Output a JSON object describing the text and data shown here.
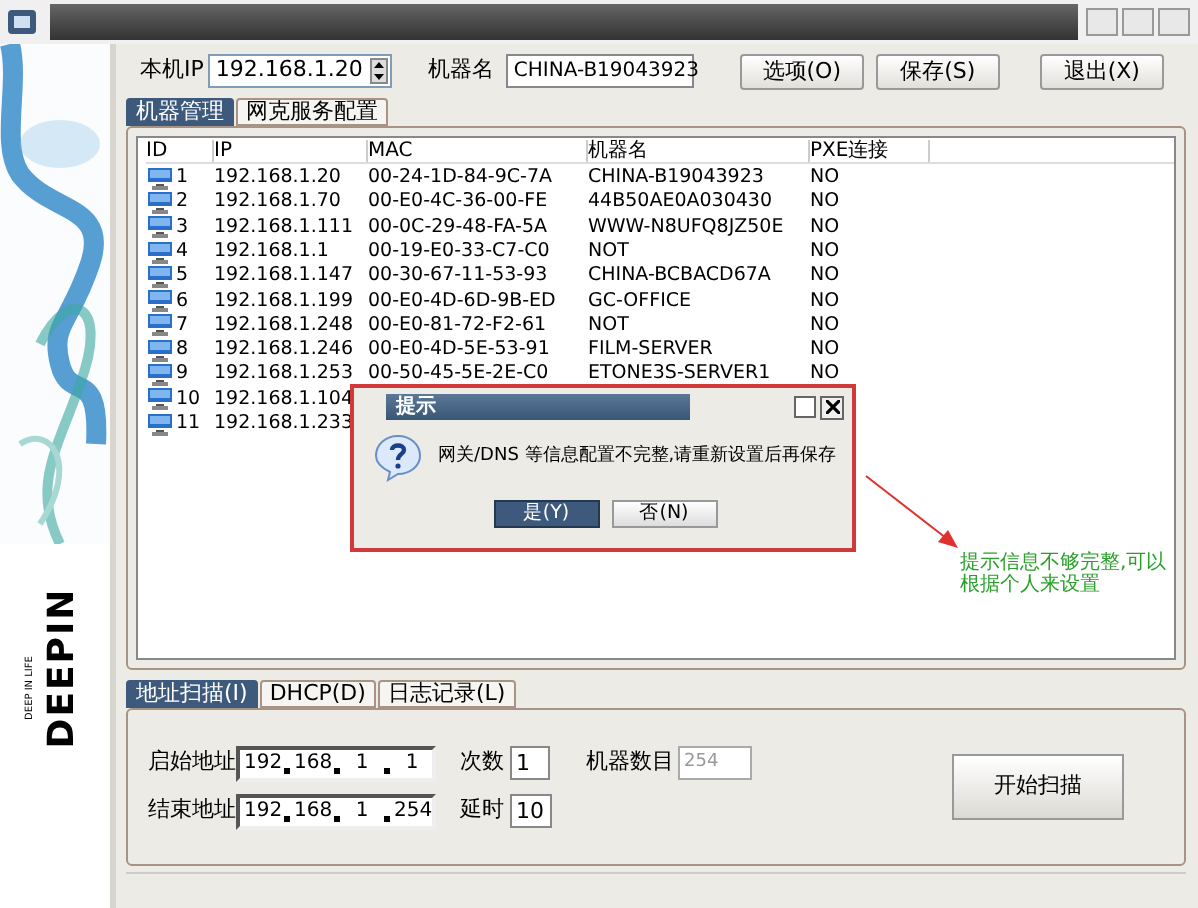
{
  "brand": {
    "wordmark": "DEEPIN",
    "tagline": "DEEP IN LIFE"
  },
  "top": {
    "ip_label": "本机IP",
    "ip_value": "192.168.1.20",
    "name_label": "机器名",
    "name_value": "CHINA-B19043923",
    "buttons": [
      "选项(O)",
      "保存(S)",
      "退出(X)"
    ]
  },
  "tabs": [
    {
      "label": "机器管理",
      "selected": true
    },
    {
      "label": "网克服务配置",
      "selected": false
    }
  ],
  "table": {
    "columns": [
      "ID",
      "IP",
      "MAC",
      "机器名",
      "PXE连接"
    ],
    "rows": [
      {
        "id": "1",
        "ip": "192.168.1.20",
        "mac": "00-24-1D-84-9C-7A",
        "name": "CHINA-B19043923",
        "pxe": "NO"
      },
      {
        "id": "2",
        "ip": "192.168.1.70",
        "mac": "00-E0-4C-36-00-FE",
        "name": "44B50AE0A030430",
        "pxe": "NO"
      },
      {
        "id": "3",
        "ip": "192.168.1.111",
        "mac": "00-0C-29-48-FA-5A",
        "name": "WWW-N8UFQ8JZ50E",
        "pxe": "NO"
      },
      {
        "id": "4",
        "ip": "192.168.1.1",
        "mac": "00-19-E0-33-C7-C0",
        "name": "NOT",
        "pxe": "NO"
      },
      {
        "id": "5",
        "ip": "192.168.1.147",
        "mac": "00-30-67-11-53-93",
        "name": "CHINA-BCBACD67A",
        "pxe": "NO"
      },
      {
        "id": "6",
        "ip": "192.168.1.199",
        "mac": "00-E0-4D-6D-9B-ED",
        "name": "GC-OFFICE",
        "pxe": "NO"
      },
      {
        "id": "7",
        "ip": "192.168.1.248",
        "mac": "00-E0-81-72-F2-61",
        "name": "NOT",
        "pxe": "NO"
      },
      {
        "id": "8",
        "ip": "192.168.1.246",
        "mac": "00-E0-4D-5E-53-91",
        "name": "FILM-SERVER",
        "pxe": "NO"
      },
      {
        "id": "9",
        "ip": "192.168.1.253",
        "mac": "00-50-45-5E-2E-C0",
        "name": "ETONE3S-SERVER1",
        "pxe": "NO"
      },
      {
        "id": "10",
        "ip": "192.168.1.104"
      },
      {
        "id": "11",
        "ip": "192.168.1.233"
      }
    ]
  },
  "bottom_tabs": [
    {
      "label": "地址扫描(I)",
      "selected": true
    },
    {
      "label": "DHCP(D)",
      "selected": false
    },
    {
      "label": "日志记录(L)",
      "selected": false
    }
  ],
  "scan": {
    "start_label": "启始地址",
    "start": [
      "192",
      "168",
      "1",
      "1"
    ],
    "end_label": "结束地址",
    "end": [
      "192",
      "168",
      "1",
      "254"
    ],
    "count_label": "次数",
    "count": "1",
    "delay_label": "延时",
    "delay": "10",
    "machines_label": "机器数目",
    "machines": "254",
    "machines_disabled": true,
    "button": "开始扫描"
  },
  "dialog": {
    "title": "提示",
    "message": "网关/DNS 等信息配置不完整,请重新设置后再保存",
    "buttons": [
      {
        "label": "是(Y)",
        "selected": true
      },
      {
        "label": "否(N)",
        "selected": false
      }
    ]
  },
  "annotation": {
    "text": "提示信息不够完整,可以根据个人来设置"
  }
}
